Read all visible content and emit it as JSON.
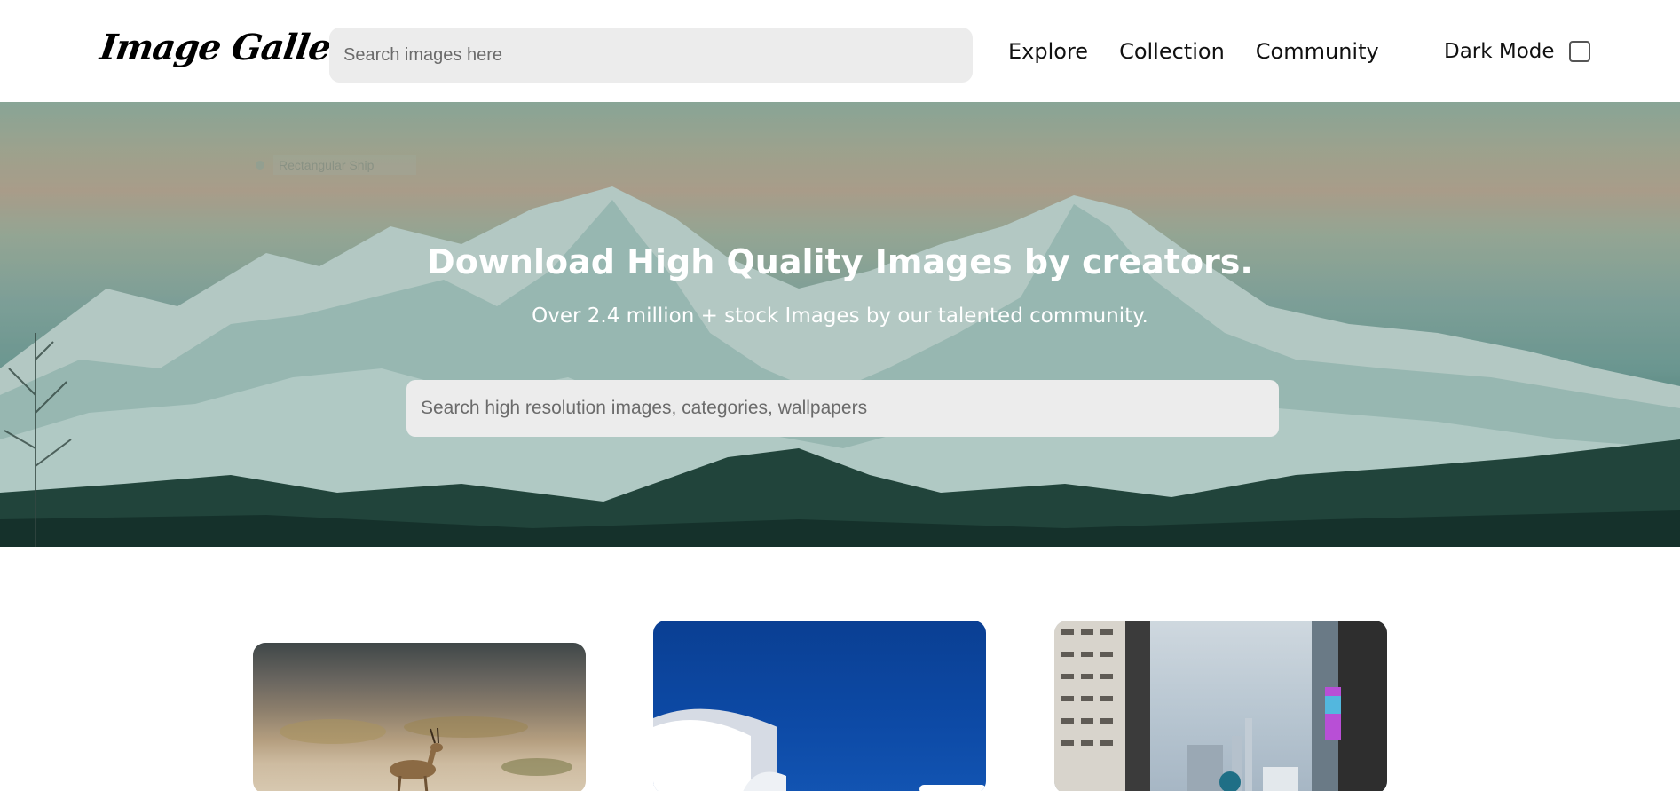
{
  "header": {
    "logo": "Image Gallery",
    "search_placeholder": "Search images here",
    "nav": [
      {
        "label": "Explore"
      },
      {
        "label": "Collection"
      },
      {
        "label": "Community"
      }
    ],
    "dark_mode_label": "Dark Mode",
    "dark_mode_checked": false
  },
  "hero": {
    "snip_hint": "Rectangular Snip",
    "title": "Download High Quality Images by creators.",
    "subtitle": "Over 2.4 million + stock Images by our talented community.",
    "search_placeholder": "Search high resolution images, categories, wallpapers",
    "background": "snow-capped-mountains"
  },
  "gallery": {
    "cards": [
      {
        "subject": "gazelle-desert-photo"
      },
      {
        "subject": "white-architecture-blue-sky-photo"
      },
      {
        "subject": "city-skyscrapers-photo"
      }
    ]
  },
  "colors": {
    "search_bg": "#ececec",
    "hero_text": "#ffffff"
  }
}
